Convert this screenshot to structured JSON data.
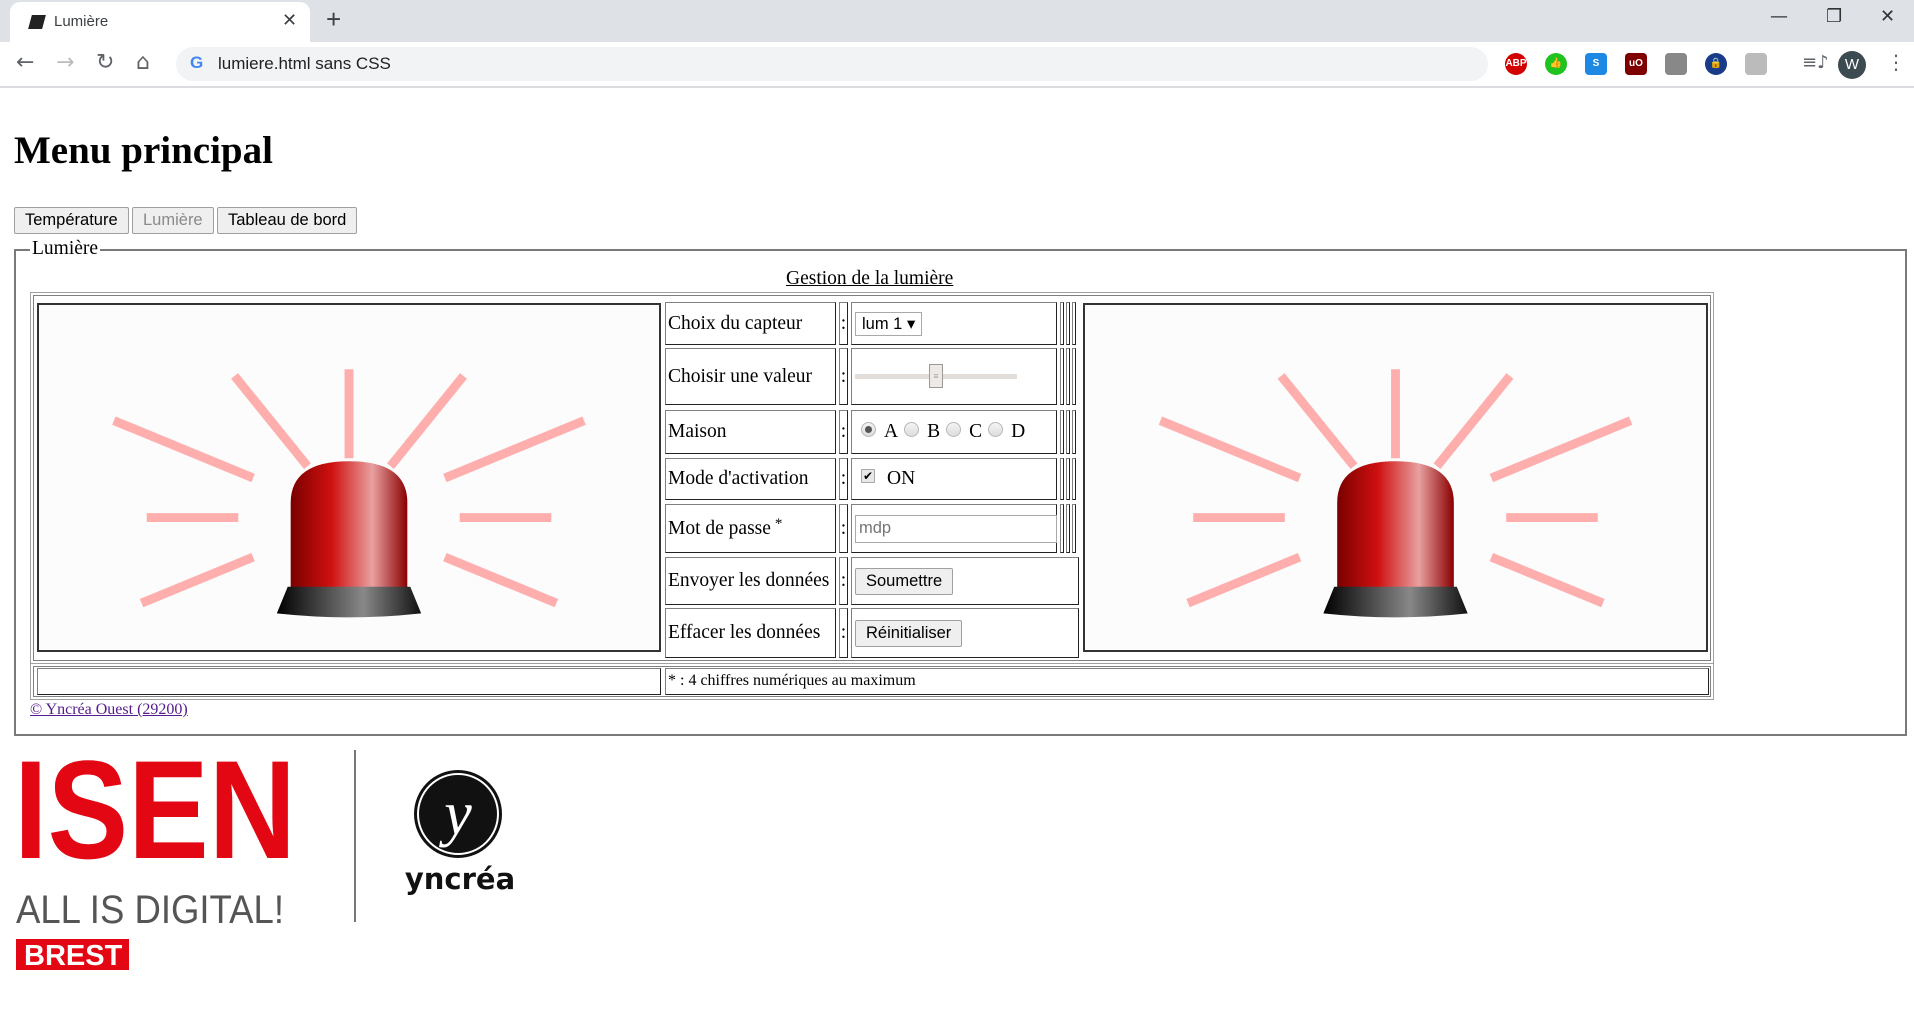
{
  "browser": {
    "tab_title": "Lumière",
    "url": "lumiere.html sans CSS",
    "avatar_letter": "W",
    "extensions": [
      {
        "name": "adblock-plus-icon",
        "label": "ABP",
        "color": "#d40000"
      },
      {
        "name": "thumbs-up-icon",
        "label": "👍",
        "color": "#1ec31e"
      },
      {
        "name": "s-extension-icon",
        "label": "S",
        "color": "#1e88e5"
      },
      {
        "name": "ublock-origin-icon",
        "label": "uO",
        "color": "#800000"
      },
      {
        "name": "circle-extension-icon",
        "label": "",
        "color": "#888888"
      },
      {
        "name": "lock-extension-icon",
        "label": "🔒",
        "color": "#1a3a8a"
      },
      {
        "name": "pdf-extension-icon",
        "label": "",
        "color": "#bbbbbb"
      }
    ]
  },
  "page": {
    "title": "Menu principal",
    "nav_buttons": [
      {
        "label": "Température",
        "disabled": false
      },
      {
        "label": "Lumière",
        "disabled": true
      },
      {
        "label": "Tableau de bord",
        "disabled": false
      }
    ],
    "fieldset_legend": "Lumière",
    "caption": "Gestion de la lumière",
    "form": {
      "sensor_label": "Choix du capteur",
      "sensor_value": "lum 1",
      "slider_label": "Choisir une valeur",
      "slider_percent": 50,
      "house_label": "Maison",
      "house_options": [
        "A",
        "B",
        "C",
        "D"
      ],
      "house_selected": "A",
      "mode_label": "Mode d'activation",
      "mode_option": "ON",
      "mode_checked": true,
      "password_label": "Mot de passe",
      "password_asterisk": "*",
      "password_placeholder": "mdp",
      "submit_label": "Envoyer les données",
      "submit_button": "Soumettre",
      "reset_label": "Effacer les données",
      "reset_button": "Réinitialiser",
      "colon": ":"
    },
    "note": "* : 4 chiffres numériques au maximum",
    "copyright": "© Yncréa Ouest (29200)",
    "logos": {
      "isen": "ISEN",
      "isen_tagline": "ALL IS DIGITAL!",
      "isen_city": "BREST",
      "yncrea": "yncréa",
      "isen_red": "#e30613"
    }
  }
}
